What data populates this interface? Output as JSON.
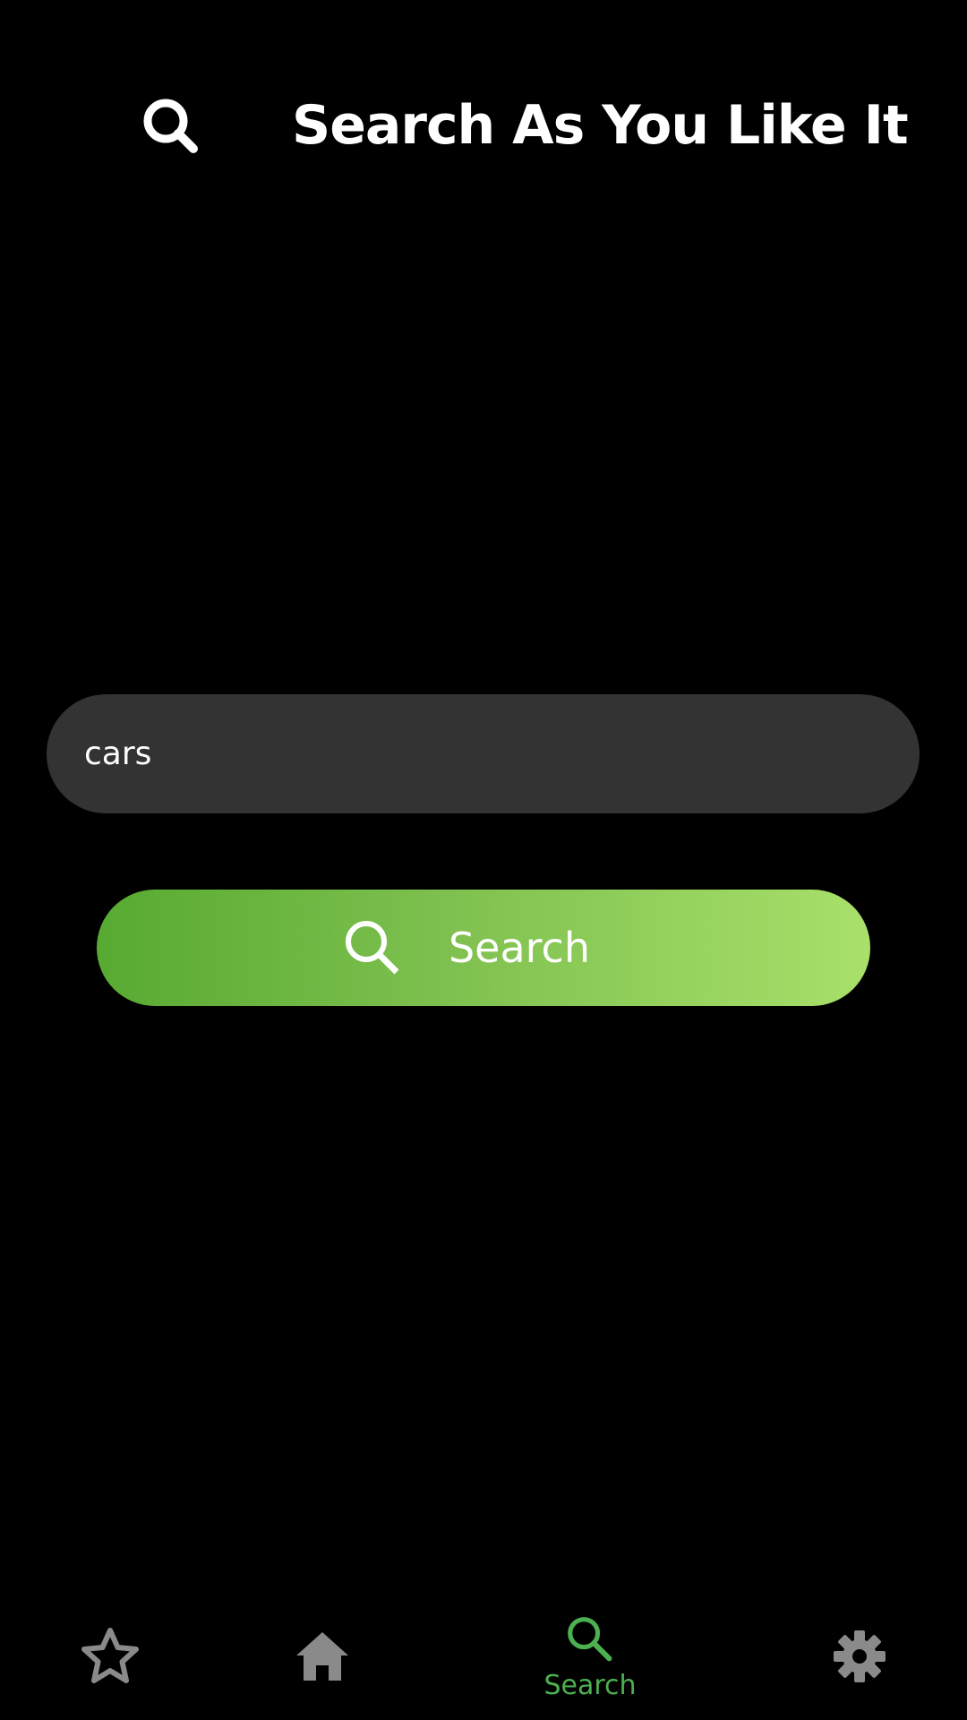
{
  "header": {
    "title": "Search As You Like It",
    "icon": "search-icon"
  },
  "search": {
    "value": "cars",
    "placeholder": ""
  },
  "search_button": {
    "label": "Search",
    "icon": "search-icon"
  },
  "bottom_nav": {
    "items": [
      {
        "icon": "star-icon",
        "label": "",
        "active": false
      },
      {
        "icon": "home-icon",
        "label": "",
        "active": false
      },
      {
        "icon": "search-icon",
        "label": "Search",
        "active": true
      },
      {
        "icon": "gear-icon",
        "label": "",
        "active": false
      }
    ]
  },
  "colors": {
    "background": "#000000",
    "field_background": "#333333",
    "accent_active": "#4caf50",
    "inactive_icon": "#8a8a8a",
    "button_gradient_start": "#57aa32",
    "button_gradient_end": "#a8e06a"
  }
}
